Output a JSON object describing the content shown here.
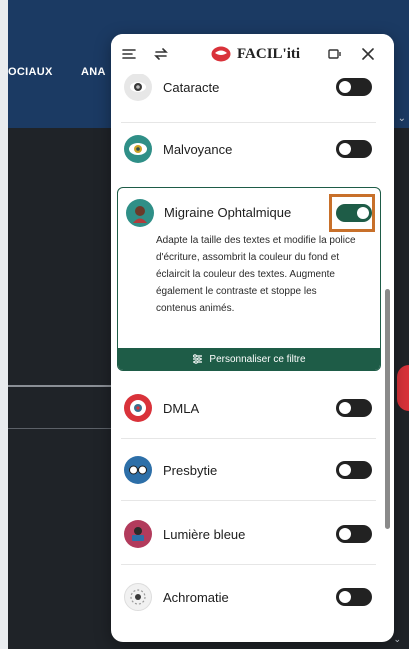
{
  "background": {
    "nav_items": [
      "OCIAUX",
      "ANA"
    ]
  },
  "panel": {
    "brand": "FACIL'iti",
    "filters": [
      {
        "label": "Cataracte",
        "icon": "eye-lens-icon",
        "enabled": false
      },
      {
        "label": "Malvoyance",
        "icon": "low-vision-eye-icon",
        "enabled": false
      },
      {
        "label": "Migraine Ophtalmique",
        "icon": "person-migraine-icon",
        "enabled": true,
        "description": "Adapte la taille des textes et modifie la police d'écriture, assombrit la couleur du fond et éclaircit la couleur des textes. Augmente également le contraste et stoppe les contenus animés.",
        "customize_label": "Personnaliser ce filtre"
      },
      {
        "label": "DMLA",
        "icon": "eye-macula-icon",
        "enabled": false
      },
      {
        "label": "Presbytie",
        "icon": "glasses-icon",
        "enabled": false
      },
      {
        "label": "Lumière bleue",
        "icon": "screen-light-icon",
        "enabled": false
      },
      {
        "label": "Achromatie",
        "icon": "color-circle-icon",
        "enabled": false
      }
    ]
  },
  "colors": {
    "accent_green": "#1e5c47",
    "brand_red": "#d9323a",
    "highlight_orange": "#c8702a",
    "site_header_blue": "#1b3a63"
  }
}
